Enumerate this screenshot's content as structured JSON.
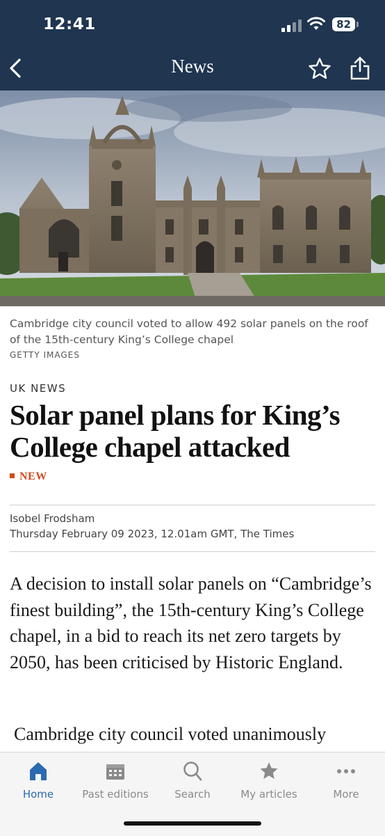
{
  "status_bar": {
    "time": "12:41",
    "battery": "82"
  },
  "nav": {
    "title": "News",
    "back_icon": "chevron-left-icon",
    "star_icon": "star-icon",
    "share_icon": "share-icon"
  },
  "hero": {
    "alt_subject": "King's College chapel photo"
  },
  "caption": {
    "text": "Cambridge city council voted to allow 492 solar panels on the roof of the 15th-century King’s College chapel",
    "credit": "GETTY IMAGES"
  },
  "article": {
    "section": "UK NEWS",
    "headline": "Solar panel plans for King’s College chapel attacked",
    "badge": "NEW",
    "author": "Isobel Frodsham",
    "dateline": "Thursday February 09 2023, 12.01am GMT, The Times",
    "paragraphs": [
      "A decision to install solar panels on “Cambridge’s finest building”, the 15th-century King’s College chapel, in a bid to reach its net zero targets by 2050, has been criticised by Historic England.",
      "Cambridge city council voted unanimously"
    ]
  },
  "tabs": [
    {
      "label": "Home",
      "icon": "home-icon",
      "active": true
    },
    {
      "label": "Past editions",
      "icon": "calendar-icon",
      "active": false
    },
    {
      "label": "Search",
      "icon": "search-icon",
      "active": false
    },
    {
      "label": "My articles",
      "icon": "star-icon",
      "active": false
    },
    {
      "label": "More",
      "icon": "more-icon",
      "active": false
    }
  ],
  "colors": {
    "header": "#1f3550",
    "accent_new": "#d34a1f",
    "active_tab": "#2a6ab0",
    "inactive_tab": "#8a8a8a"
  }
}
